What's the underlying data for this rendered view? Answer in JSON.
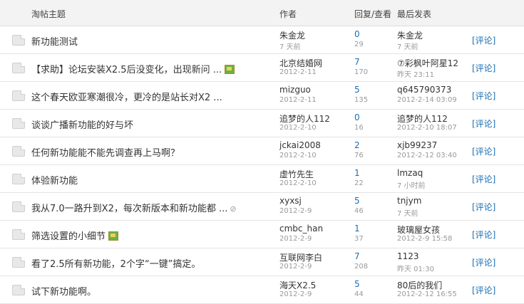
{
  "header": {
    "subject": "淘帖主题",
    "author": "作者",
    "stats": "回复/查看",
    "last": "最后发表"
  },
  "rows": [
    {
      "title": "新功能测试",
      "author": "朱金龙",
      "date": "7 天前",
      "replies": "0",
      "views": "29",
      "last_user": "朱金龙",
      "last_time": "7 天前",
      "comment": "[评论]",
      "icon": ""
    },
    {
      "title": "【求助】论坛安装X2.5后没变化，出现新问 ...",
      "author": "北京结婚网",
      "date": "2012-2-11",
      "replies": "7",
      "views": "170",
      "last_user": "⑦彩枫叶阿星12",
      "last_time": "昨天 23:11",
      "comment": "[评论]",
      "icon": "image-icon"
    },
    {
      "title": "这个春天欧亚寒潮很冷，更冷的是站长对X2 ...",
      "author": "mizguo",
      "date": "2012-2-11",
      "replies": "5",
      "views": "135",
      "last_user": "q645790373",
      "last_time": "2012-2-14 03:09",
      "comment": "[评论]",
      "icon": ""
    },
    {
      "title": "谈谈广播新功能的好与坏",
      "author": "追梦的人112",
      "date": "2012-2-10",
      "replies": "0",
      "views": "16",
      "last_user": "追梦的人112",
      "last_time": "2012-2-10 18:07",
      "comment": "[评论]",
      "icon": ""
    },
    {
      "title": "任何新功能能不能先调查再上马啊？",
      "author": "jckai2008",
      "date": "2012-2-10",
      "replies": "2",
      "views": "76",
      "last_user": "xjb99237",
      "last_time": "2012-2-12 03:40",
      "comment": "[评论]",
      "icon": ""
    },
    {
      "title": "体验新功能",
      "author": "虚竹先生",
      "date": "2012-2-10",
      "replies": "1",
      "views": "22",
      "last_user": "lmzaq",
      "last_time": "7 小时前",
      "comment": "[评论]",
      "icon": ""
    },
    {
      "title": "我从7.0一路升到X2，每次新版本和新功能都 ...",
      "author": "xyxsj",
      "date": "2012-2-9",
      "replies": "5",
      "views": "46",
      "last_user": "tnjym",
      "last_time": "7 天前",
      "comment": "[评论]",
      "icon": "attachment-icon"
    },
    {
      "title": "筛选设置的小细节",
      "author": "cmbc_han",
      "date": "2012-2-9",
      "replies": "1",
      "views": "37",
      "last_user": "玻璃屋女孩",
      "last_time": "2012-2-9 15:58",
      "comment": "[评论]",
      "icon": "image-icon"
    },
    {
      "title": "看了2.5所有新功能，2个字“一键”搞定。",
      "author": "互联网李白",
      "date": "2012-2-9",
      "replies": "7",
      "views": "208",
      "last_user": "1123",
      "last_time": "昨天 01:30",
      "comment": "[评论]",
      "icon": ""
    },
    {
      "title": "试下新功能啊。",
      "author": "海天X2.5",
      "date": "2012-2-9",
      "replies": "5",
      "views": "44",
      "last_user": "80后的我们",
      "last_time": "2012-2-12 16:55",
      "comment": "[评论]",
      "icon": ""
    }
  ]
}
